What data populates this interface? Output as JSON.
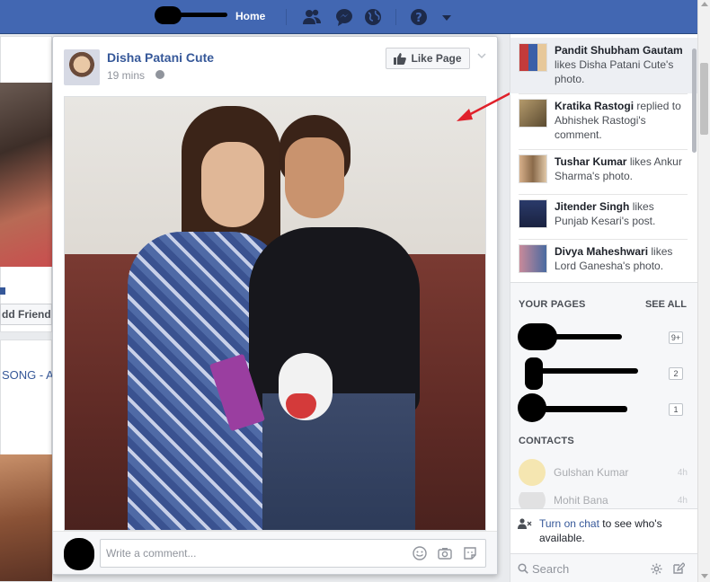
{
  "topbar": {
    "home_label": "Home",
    "icons": [
      "friend-requests-icon",
      "messenger-icon",
      "notifications-globe-icon",
      "help-icon",
      "account-menu-chevron-icon"
    ]
  },
  "background_feed": {
    "add_friend_label": "dd Friend",
    "song_link": "SONG - A"
  },
  "post": {
    "page_name": "Disha Patani Cute",
    "time": "19 mins",
    "like_page_label": "Like Page",
    "comment_placeholder": "Write a comment..."
  },
  "ticker": [
    {
      "name": "Pandit Shubham Gautam",
      "action": "likes Disha Patani Cute's photo."
    },
    {
      "name": "Kratika Rastogi",
      "action": "replied to Abhishek Rastogi's comment."
    },
    {
      "name": "Tushar Kumar",
      "action": "likes Ankur Sharma's photo."
    },
    {
      "name": "Jitender Singh",
      "action": "likes Punjab Kesari's post."
    },
    {
      "name": "Divya Maheshwari",
      "action": "likes Lord Ganesha's photo."
    }
  ],
  "your_pages": {
    "title": "YOUR PAGES",
    "see_all": "SEE ALL",
    "badges": [
      "9+",
      "2",
      "1"
    ]
  },
  "contacts": {
    "title": "CONTACTS",
    "items": [
      {
        "name": "Gulshan Kumar",
        "time": "4h"
      },
      {
        "name": "Mohit Bana",
        "time": "4h"
      }
    ]
  },
  "chat": {
    "turn_on_link": "Turn on chat",
    "notice_rest": " to see who's available.",
    "search_placeholder": "Search"
  },
  "colors": {
    "brand_blue": "#4267b2",
    "link_blue": "#365899",
    "annotation_red": "#e0202a"
  }
}
